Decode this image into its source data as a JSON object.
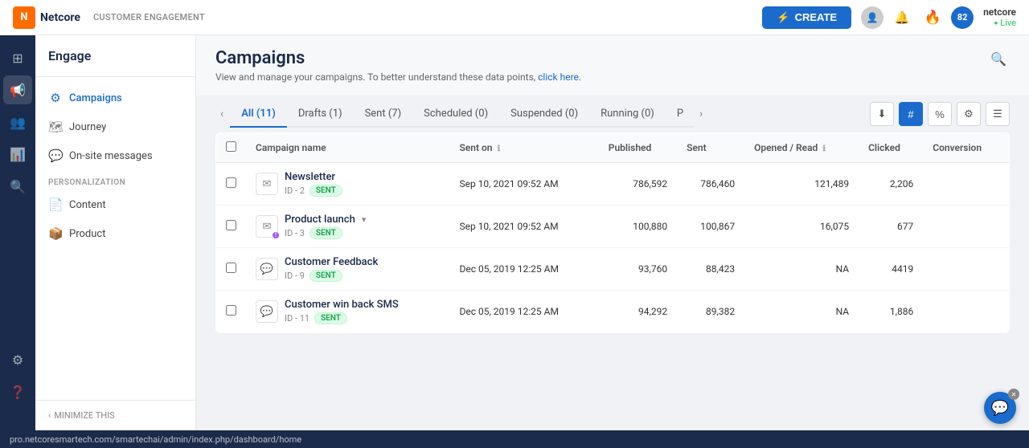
{
  "topbar": {
    "logo_letter": "N",
    "brand": "Netcore",
    "subtitle": "Customer Engagement",
    "create_label": "CREATE",
    "create_icon": "⚡",
    "account_name": "netcore",
    "account_status": "Live",
    "avatar_score": "82"
  },
  "sidebar": {
    "title": "Engage",
    "items": [
      {
        "id": "campaigns",
        "label": "Campaigns",
        "icon": "📢",
        "active": true
      },
      {
        "id": "journey",
        "label": "Journey",
        "icon": "🗺"
      },
      {
        "id": "onsite",
        "label": "On-site messages",
        "icon": "💬"
      }
    ],
    "personalization_label": "PERSONALIZATION",
    "personalization_items": [
      {
        "id": "content",
        "label": "Content",
        "icon": "📄"
      },
      {
        "id": "product",
        "label": "Product",
        "icon": "📦"
      }
    ],
    "minimize_label": "MINIMIZE THIS"
  },
  "page": {
    "title": "Campaigns",
    "subtitle": "View and manage your campaigns. To better understand these data points,",
    "subtitle_link": "click here."
  },
  "tabs": [
    {
      "id": "all",
      "label": "All (11)",
      "active": true
    },
    {
      "id": "drafts",
      "label": "Drafts (1)"
    },
    {
      "id": "sent",
      "label": "Sent (7)"
    },
    {
      "id": "scheduled",
      "label": "Scheduled (0)"
    },
    {
      "id": "suspended",
      "label": "Suspended (0)"
    },
    {
      "id": "running",
      "label": "Running (0)"
    },
    {
      "id": "p",
      "label": "P"
    }
  ],
  "table": {
    "columns": [
      {
        "id": "name",
        "label": "Campaign name"
      },
      {
        "id": "sent_on",
        "label": "Sent on",
        "has_info": true
      },
      {
        "id": "published",
        "label": "Published"
      },
      {
        "id": "sent",
        "label": "Sent"
      },
      {
        "id": "opened_read",
        "label": "Opened / Read",
        "has_info": true
      },
      {
        "id": "clicked",
        "label": "Clicked"
      },
      {
        "id": "conversion",
        "label": "Conversion"
      }
    ],
    "rows": [
      {
        "id": "2",
        "name": "Newsletter",
        "id_label": "ID - 2",
        "status": "SENT",
        "status_type": "sent",
        "type_icon": "✉",
        "has_badge": false,
        "has_chevron": false,
        "sent_on": "Sep 10, 2021 09:52 AM",
        "published": "786,592",
        "sent": "786,460",
        "opened_read": "121,489",
        "clicked": "2,206",
        "conversion": ""
      },
      {
        "id": "3",
        "name": "Product launch",
        "id_label": "ID - 3",
        "status": "SENT",
        "status_type": "sent",
        "type_icon": "✉",
        "has_badge": true,
        "has_chevron": true,
        "sent_on": "Sep 10, 2021 09:52 AM",
        "published": "100,880",
        "sent": "100,867",
        "opened_read": "16,075",
        "clicked": "677",
        "conversion": ""
      },
      {
        "id": "9",
        "name": "Customer Feedback",
        "id_label": "ID - 9",
        "status": "SENT",
        "status_type": "sent",
        "type_icon": "💬",
        "has_badge": false,
        "has_chevron": false,
        "sent_on": "Dec 05, 2019 12:25 AM",
        "published": "93,760",
        "sent": "88,423",
        "opened_read": "NA",
        "clicked": "4419",
        "conversion": ""
      },
      {
        "id": "11",
        "name": "Customer win back SMS",
        "id_label": "ID - 11",
        "status": "SENT",
        "status_type": "sent",
        "type_icon": "💬",
        "has_badge": false,
        "has_chevron": false,
        "sent_on": "Dec 05, 2019 12:25 AM",
        "published": "94,292",
        "sent": "89,382",
        "opened_read": "NA",
        "clicked": "1,886",
        "conversion": ""
      }
    ]
  },
  "statusbar": {
    "url": "pro.netcoresmartech.com/smartechai/admin/index.php/dashboard/home"
  }
}
